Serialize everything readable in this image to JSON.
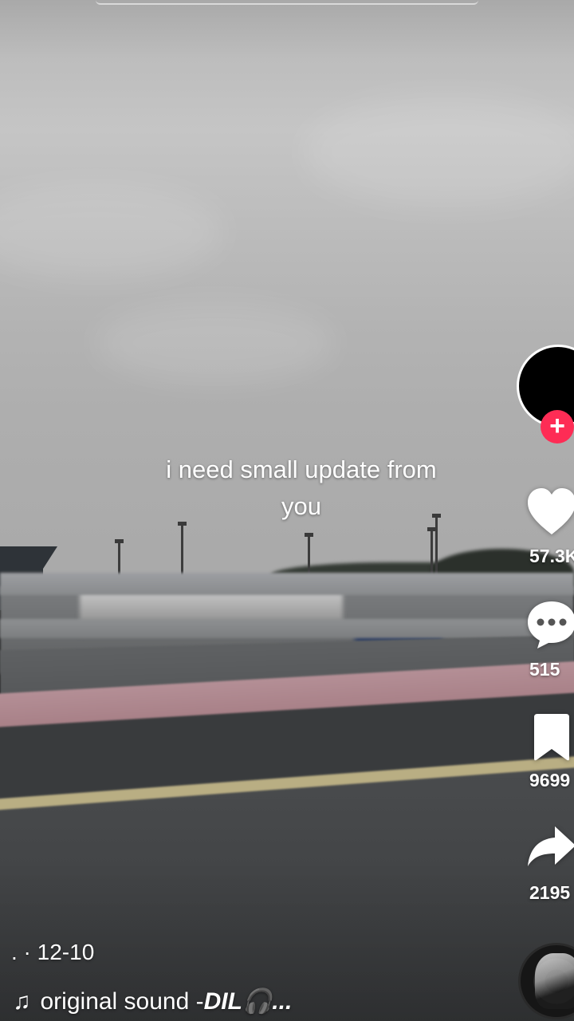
{
  "video": {
    "caption": "i need small update from\nyou"
  },
  "creator": {
    "follow_symbol": "+"
  },
  "actions": {
    "like_count": "57.3K",
    "comment_count": "515",
    "save_count": "9699",
    "share_count": "2195"
  },
  "meta": {
    "date": ". · 12-10",
    "sound_prefix": "original sound - ",
    "sound_name": "DIL🎧..."
  },
  "icons": {
    "like": "heart-icon",
    "comment": "comment-bubble-icon",
    "save": "bookmark-icon",
    "share": "share-arrow-icon",
    "sound": "music-note-icon"
  },
  "colors": {
    "follow_badge": "#fe2c55",
    "icon": "#ffffff"
  }
}
